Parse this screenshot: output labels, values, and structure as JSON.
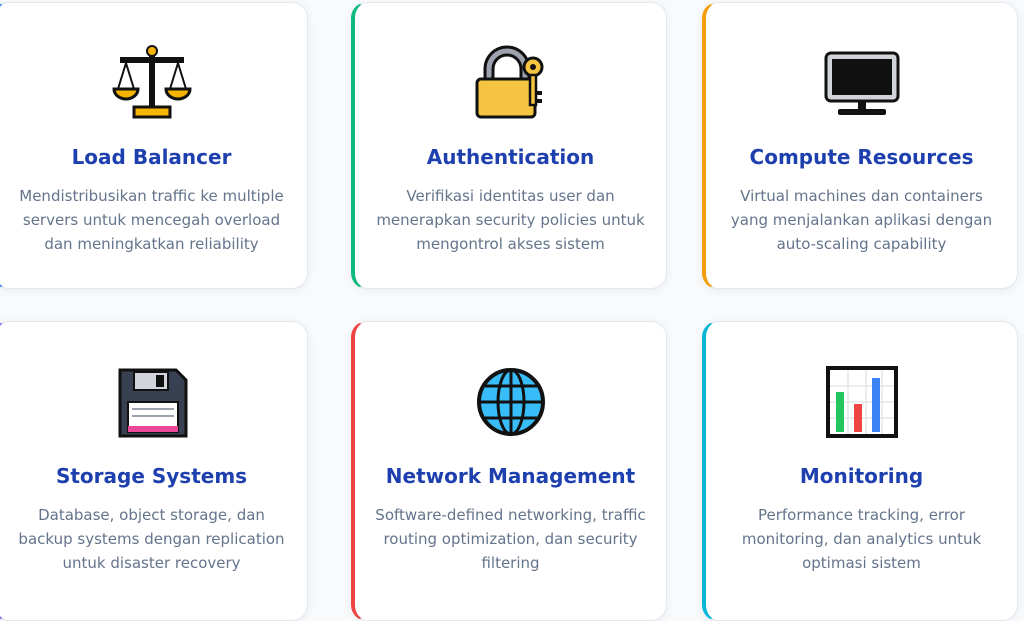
{
  "accents": {
    "blue": "#3b82f6",
    "green": "#10b981",
    "orange": "#f59e0b",
    "purple": "#8b5cf6",
    "red": "#ef4444",
    "cyan": "#06b6d4"
  },
  "cards": [
    {
      "icon": "balance-scale-icon",
      "title": "Load Balancer",
      "description": "Mendistribusikan traffic ke multiple servers untuk mencegah overload dan meningkatkan reliability"
    },
    {
      "icon": "lock-with-key-icon",
      "title": "Authentication",
      "description": "Verifikasi identitas user dan menerapkan security policies untuk mengontrol akses sistem"
    },
    {
      "icon": "monitor-icon",
      "title": "Compute Resources",
      "description": "Virtual machines dan containers yang menjalankan aplikasi dengan auto-scaling capability"
    },
    {
      "icon": "floppy-disk-icon",
      "title": "Storage Systems",
      "description": "Database, object storage, dan backup systems dengan replication untuk disaster recovery"
    },
    {
      "icon": "globe-icon",
      "title": "Network Management",
      "description": "Software-defined networking, traffic routing optimization, dan security filtering"
    },
    {
      "icon": "bar-chart-icon",
      "title": "Monitoring",
      "description": "Performance tracking, error monitoring, dan analytics untuk optimasi sistem"
    }
  ]
}
